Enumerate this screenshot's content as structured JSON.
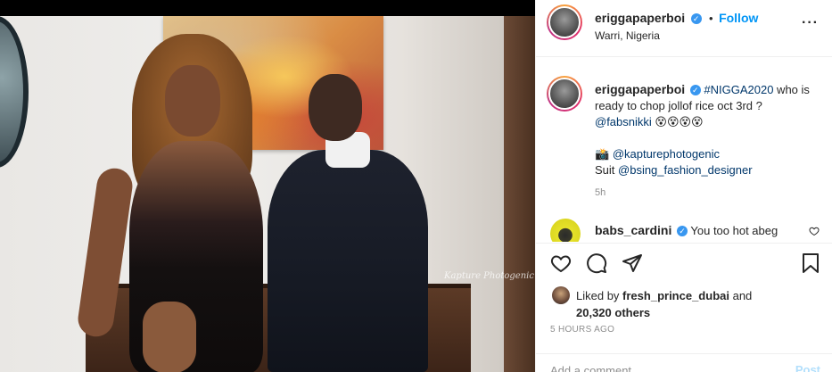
{
  "post": {
    "author": "eriggapaperboi",
    "follow_label": "Follow",
    "location": "Warri, Nigeria",
    "caption": {
      "hashtag": "#NIGGA2020",
      "line1_rest": " who is ready to chop jollof rice oct 3rd ?",
      "mention_fab": "@fabsnikki",
      "emoji": " 😵😵😵😵",
      "camera_glyph": "📸",
      "photog_mention": "@kapturephotogenic",
      "suit_prefix": "Suit ",
      "suit_mention": "@bsing_fashion_designer"
    },
    "caption_time": "5h",
    "comment": {
      "username": "babs_cardini",
      "text": "You too hot abeg"
    },
    "likes": {
      "prefix": "Liked by ",
      "first_liker": "fresh_prince_dubai",
      "and": " and",
      "others": "20,320 others"
    },
    "posted_ago": "5 HOURS AGO",
    "add_comment_placeholder": "Add a comment…",
    "post_label": "Post",
    "photo_watermark": "Kapture Photogenic"
  },
  "icons": {
    "verified": "verified-badge-icon",
    "like": "heart-icon",
    "comment": "comment-bubble-icon",
    "share": "paper-plane-icon",
    "save": "bookmark-icon",
    "more": "ellipsis-icon"
  },
  "colors": {
    "link_blue": "#0095f6",
    "verified_blue": "#3897f0",
    "mention_blue": "#00376b",
    "muted_gray": "#8e8e8e",
    "post_disabled": "#b2dffc"
  }
}
